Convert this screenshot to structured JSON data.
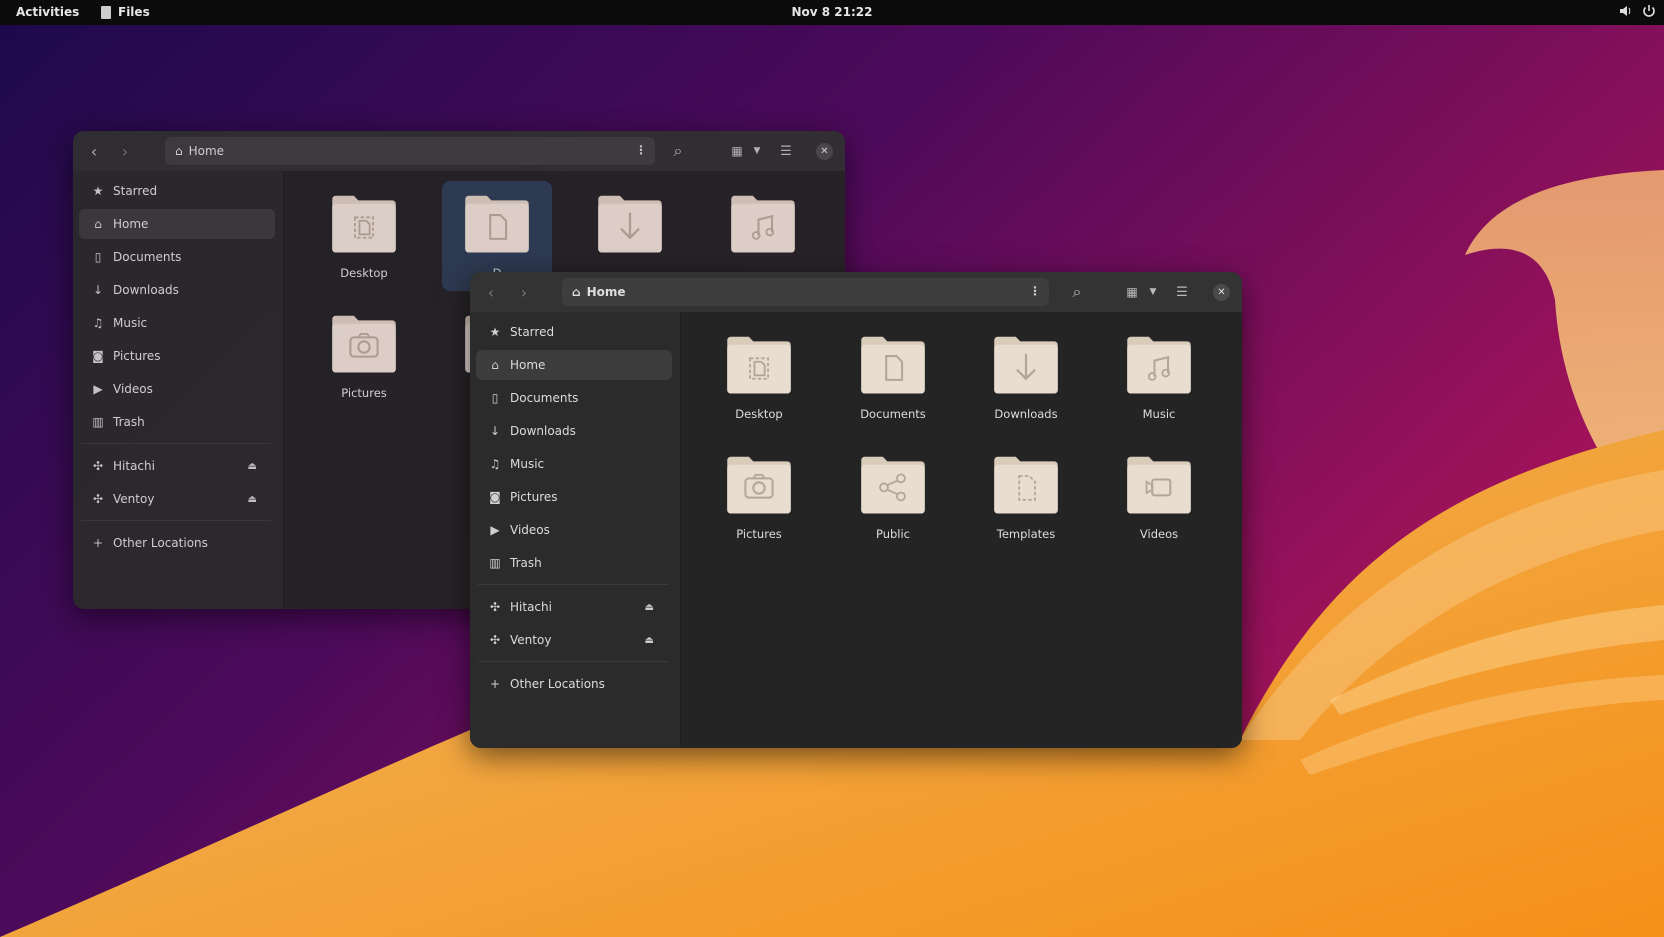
{
  "topbar": {
    "activities": "Activities",
    "app_name": "Files",
    "clock": "Nov 8  21:22",
    "tray_icons": [
      "volume-icon",
      "power-icon"
    ]
  },
  "back_window": {
    "location": "Home",
    "sidebar": [
      {
        "label": "Starred",
        "icon": "star-icon"
      },
      {
        "label": "Home",
        "icon": "home-icon",
        "active": true
      },
      {
        "label": "Documents",
        "icon": "document-icon"
      },
      {
        "label": "Downloads",
        "icon": "download-icon"
      },
      {
        "label": "Music",
        "icon": "music-icon"
      },
      {
        "label": "Pictures",
        "icon": "camera-icon"
      },
      {
        "label": "Videos",
        "icon": "video-icon"
      },
      {
        "label": "Trash",
        "icon": "trash-icon"
      }
    ],
    "devices": [
      {
        "label": "Hitachi",
        "icon": "usb-icon"
      },
      {
        "label": "Ventoy",
        "icon": "usb-icon"
      }
    ],
    "other_locations": "Other Locations",
    "files": [
      {
        "name": "Desktop",
        "icon": "desktop"
      },
      {
        "name": "D",
        "icon": "document",
        "selected": true
      },
      {
        "name": "",
        "icon": "download"
      },
      {
        "name": "",
        "icon": "music"
      },
      {
        "name": "Pictures",
        "icon": "camera"
      },
      {
        "name": "",
        "icon": "document"
      }
    ]
  },
  "front_window": {
    "location": "Home",
    "sidebar": [
      {
        "label": "Starred",
        "icon": "star-icon"
      },
      {
        "label": "Home",
        "icon": "home-icon",
        "active": true
      },
      {
        "label": "Documents",
        "icon": "document-icon"
      },
      {
        "label": "Downloads",
        "icon": "download-icon"
      },
      {
        "label": "Music",
        "icon": "music-icon"
      },
      {
        "label": "Pictures",
        "icon": "camera-icon"
      },
      {
        "label": "Videos",
        "icon": "video-icon"
      },
      {
        "label": "Trash",
        "icon": "trash-icon"
      }
    ],
    "devices": [
      {
        "label": "Hitachi",
        "icon": "usb-icon"
      },
      {
        "label": "Ventoy",
        "icon": "usb-icon"
      }
    ],
    "other_locations": "Other Locations",
    "files": [
      {
        "name": "Desktop",
        "icon": "desktop"
      },
      {
        "name": "Documents",
        "icon": "document"
      },
      {
        "name": "Downloads",
        "icon": "download"
      },
      {
        "name": "Music",
        "icon": "music"
      },
      {
        "name": "Pictures",
        "icon": "camera"
      },
      {
        "name": "Public",
        "icon": "share"
      },
      {
        "name": "Templates",
        "icon": "template"
      },
      {
        "name": "Videos",
        "icon": "video"
      }
    ]
  },
  "colors": {
    "folder": "#e8ddd0",
    "folder_tab": "#d9cbba",
    "glyph": "#b4a696",
    "selection": "#355478"
  }
}
